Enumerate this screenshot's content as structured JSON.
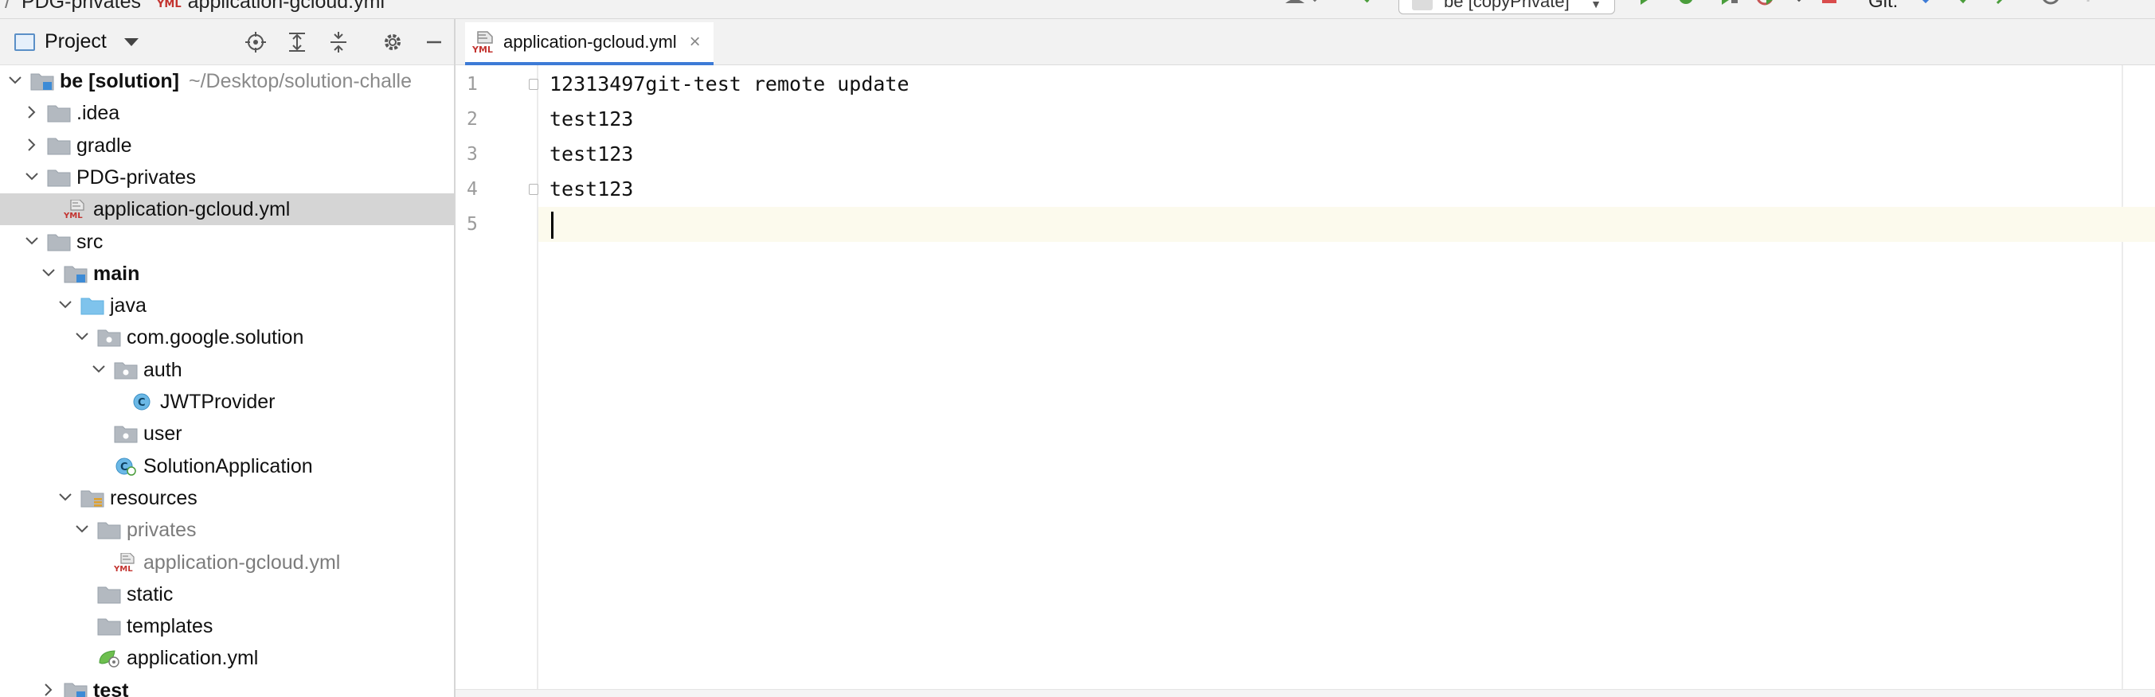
{
  "breadcrumb": {
    "items": [
      "PDG-privates",
      "application-gcloud.yml"
    ],
    "separator": "/"
  },
  "toolbar": {
    "run_config": "be [copyPrivate]",
    "git_label": "Git:"
  },
  "project_panel": {
    "title": "Project",
    "tree": [
      {
        "label": "be [solution]",
        "path": "~/Desktop/solution-challe",
        "depth": 0,
        "expanded": true,
        "icon": "module-folder-icon",
        "bold": true
      },
      {
        "label": ".idea",
        "depth": 1,
        "expanded": false,
        "icon": "folder-icon"
      },
      {
        "label": "gradle",
        "depth": 1,
        "expanded": false,
        "icon": "folder-icon"
      },
      {
        "label": "PDG-privates",
        "depth": 1,
        "expanded": true,
        "icon": "folder-icon"
      },
      {
        "label": "application-gcloud.yml",
        "depth": 2,
        "icon": "yml-file-icon",
        "selected": true
      },
      {
        "label": "src",
        "depth": 1,
        "expanded": true,
        "icon": "folder-icon"
      },
      {
        "label": "main",
        "depth": 2,
        "expanded": true,
        "icon": "source-root-folder-icon",
        "bold": true
      },
      {
        "label": "java",
        "depth": 3,
        "expanded": true,
        "icon": "java-folder-icon"
      },
      {
        "label": "com.google.solution",
        "depth": 4,
        "expanded": true,
        "icon": "package-icon"
      },
      {
        "label": "auth",
        "depth": 5,
        "expanded": true,
        "icon": "package-icon"
      },
      {
        "label": "JWTProvider",
        "depth": 6,
        "icon": "java-class-icon"
      },
      {
        "label": "user",
        "depth": 5,
        "icon": "package-icon"
      },
      {
        "label": "SolutionApplication",
        "depth": 5,
        "icon": "spring-boot-class-icon"
      },
      {
        "label": "resources",
        "depth": 3,
        "expanded": true,
        "icon": "resources-folder-icon"
      },
      {
        "label": "privates",
        "depth": 4,
        "expanded": true,
        "icon": "folder-icon",
        "gray": true
      },
      {
        "label": "application-gcloud.yml",
        "depth": 5,
        "icon": "yml-file-icon",
        "gray": true
      },
      {
        "label": "static",
        "depth": 4,
        "icon": "folder-icon"
      },
      {
        "label": "templates",
        "depth": 4,
        "icon": "folder-icon"
      },
      {
        "label": "application.yml",
        "depth": 4,
        "icon": "spring-config-file-icon"
      },
      {
        "label": "test",
        "depth": 2,
        "expanded": false,
        "icon": "source-root-folder-icon",
        "bold": true
      }
    ]
  },
  "editor": {
    "tab": {
      "label": "application-gcloud.yml",
      "close": "×"
    },
    "lines": [
      {
        "number": "1",
        "text": "12313497git-test remote update"
      },
      {
        "number": "2",
        "text": "test123"
      },
      {
        "number": "3",
        "text": "test123"
      },
      {
        "number": "4",
        "text": "test123"
      },
      {
        "number": "5",
        "text": ""
      }
    ],
    "current_line": 5
  },
  "colors": {
    "selection": "#d5d5d5",
    "current_line": "#fcfaed",
    "tab_underline": "#3d7bd6",
    "yml_badge": "#c3332f",
    "folder": "#9aa2ab",
    "java_folder": "#6bb5e5"
  }
}
